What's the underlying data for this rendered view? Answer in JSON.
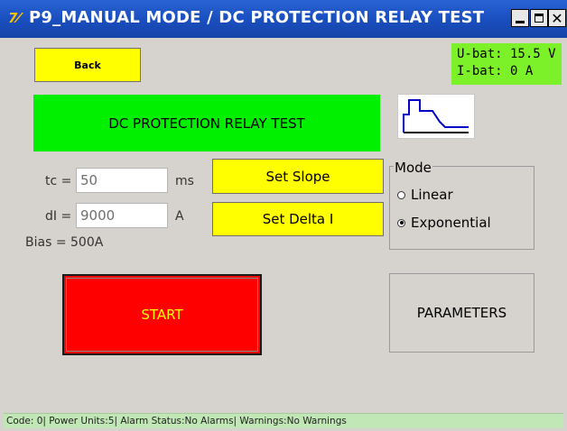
{
  "window": {
    "title": "P9_MANUAL MODE / DC PROTECTION RELAY TEST",
    "controls": {
      "minimize": "minimize-icon",
      "maximize": "maximize-icon",
      "close": "close-icon"
    }
  },
  "battery": {
    "voltage": "U-bat: 15.5 V",
    "current": "I-bat: 0 A"
  },
  "buttons": {
    "back": "Back",
    "set_slope": "Set Slope",
    "set_delta": "Set Delta I",
    "start": "START",
    "parameters": "PARAMETERS"
  },
  "banner": "DC PROTECTION RELAY TEST",
  "fields": {
    "tc": {
      "label": "tc =",
      "value": "50",
      "unit": "ms"
    },
    "di": {
      "label": "dI =",
      "value": "9000",
      "unit": "A"
    }
  },
  "bias": "Bias = 500A",
  "mode": {
    "legend": "Mode",
    "options": [
      "Linear",
      "Exponential"
    ],
    "selected": "Exponential"
  },
  "status_bar": "Code: 0| Power Units:5| Alarm Status:No Alarms| Warnings:No Warnings",
  "colors": {
    "title_bg": "#1a4fc0",
    "yellow": "#ffff00",
    "green": "#00f000",
    "red": "#ff0000",
    "status_green": "#7cf028"
  }
}
